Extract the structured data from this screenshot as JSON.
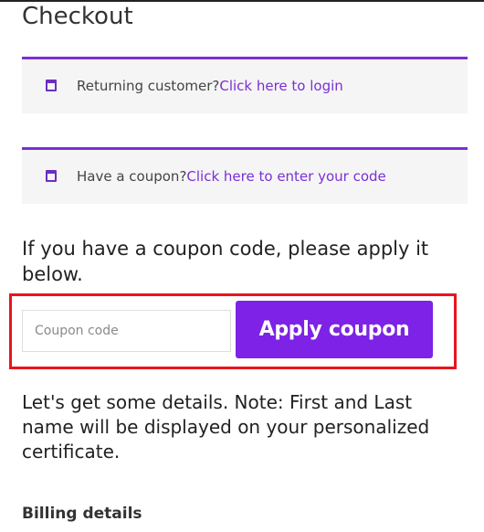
{
  "page": {
    "title": "Checkout"
  },
  "notices": {
    "login": {
      "text": "Returning customer?",
      "link": "Click here to login"
    },
    "coupon": {
      "text": "Have a coupon?",
      "link": "Click here to enter your code"
    }
  },
  "coupon_form": {
    "instruction": "If you have a coupon code, please apply it below.",
    "input_value": "",
    "input_placeholder": "Coupon code",
    "apply_label": "Apply coupon"
  },
  "details": {
    "note": "Let's get some details. Note: First and Last name will be displayed on your personalized certificate.",
    "billing_heading": "Billing details"
  },
  "colors": {
    "accent": "#7d22e6",
    "notice_border": "#7b2fd6",
    "highlight_border": "#e8141e",
    "notice_bg": "#f5f5f5"
  },
  "icons": {
    "notice": "window-icon"
  }
}
